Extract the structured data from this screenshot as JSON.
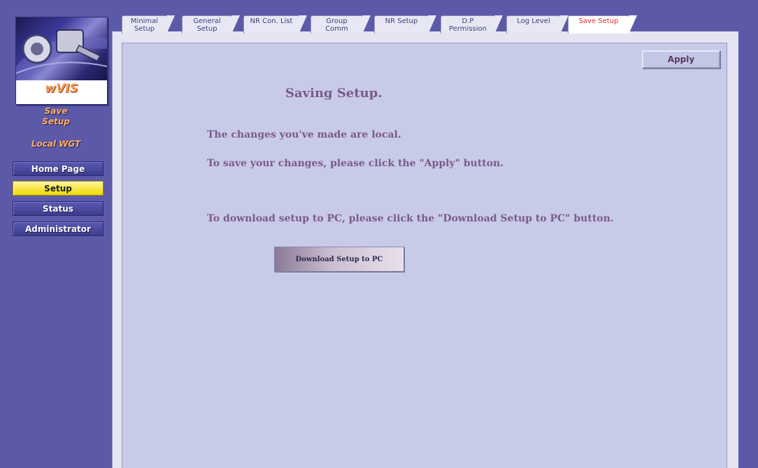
{
  "sidebar": {
    "logo_text": "wVIS",
    "section_label_line1": "Save",
    "section_label_line2": "Setup",
    "device_label": "Local WGT",
    "nav": [
      {
        "label": "Home Page",
        "active": false
      },
      {
        "label": "Setup",
        "active": true
      },
      {
        "label": "Status",
        "active": false
      },
      {
        "label": "Administrator",
        "active": false
      }
    ]
  },
  "tabs": [
    {
      "line1": "Minimal",
      "line2": "Setup",
      "active": false
    },
    {
      "line1": "General",
      "line2": "Setup",
      "active": false
    },
    {
      "line1": "NR Con. List",
      "line2": "",
      "active": false
    },
    {
      "line1": "Group",
      "line2": "Comm",
      "active": false
    },
    {
      "line1": "NR Setup",
      "line2": "",
      "active": false
    },
    {
      "line1": "D.P",
      "line2": "Permission",
      "active": false
    },
    {
      "line1": "Log Level",
      "line2": "",
      "active": false
    },
    {
      "line1": "Save Setup",
      "line2": "",
      "active": true
    }
  ],
  "main": {
    "apply_label": "Apply",
    "title": "Saving Setup.",
    "message_local": "The changes you've made are local.",
    "message_apply": "To save your changes, please click the \"Apply\" button.",
    "message_download": "To download setup to PC, please click the \"Download Setup to PC\" button.",
    "download_label": "Download Setup to PC"
  },
  "colors": {
    "background": "#5c5aa8",
    "content_panel": "#c8cbe8",
    "active_nav": "#f0d800",
    "active_tab_text": "#e0302a",
    "text": "#7a5a8a"
  }
}
